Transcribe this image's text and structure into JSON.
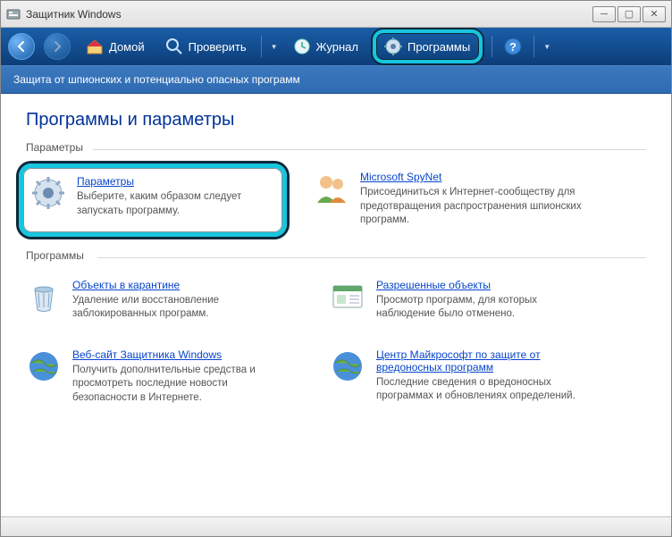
{
  "window": {
    "title": "Защитник Windows"
  },
  "toolbar": {
    "home": "Домой",
    "scan": "Проверить",
    "log": "Журнал",
    "programs": "Программы"
  },
  "subheader": "Защита от шпионских  и потенциально опасных программ",
  "page_title": "Программы и параметры",
  "groups": {
    "settings_label": "Параметры",
    "programs_label": "Программы"
  },
  "cards": {
    "settings": {
      "title": "Параметры",
      "desc": "Выберите, каким образом следует запускать программу."
    },
    "spynet": {
      "title": "Microsoft SpyNet",
      "desc": "Присоединиться к Интернет-сообществу для предотвращения распространения шпионских программ."
    },
    "quarantine": {
      "title": "Объекты в карантине",
      "desc": "Удаление или восстановление заблокированных программ."
    },
    "allowed": {
      "title": "Разрешенные объекты",
      "desc": "Просмотр программ, для которых наблюдение было отменено."
    },
    "website": {
      "title": "Веб-сайт Защитника Windows",
      "desc": "Получить дополнительные средства и просмотреть последние новости безопасности в Интернете."
    },
    "mpc": {
      "title": "Центр Майкрософт по защите от вредоносных программ",
      "desc": "Последние сведения о вредоносных программах и обновлениях определений."
    }
  }
}
